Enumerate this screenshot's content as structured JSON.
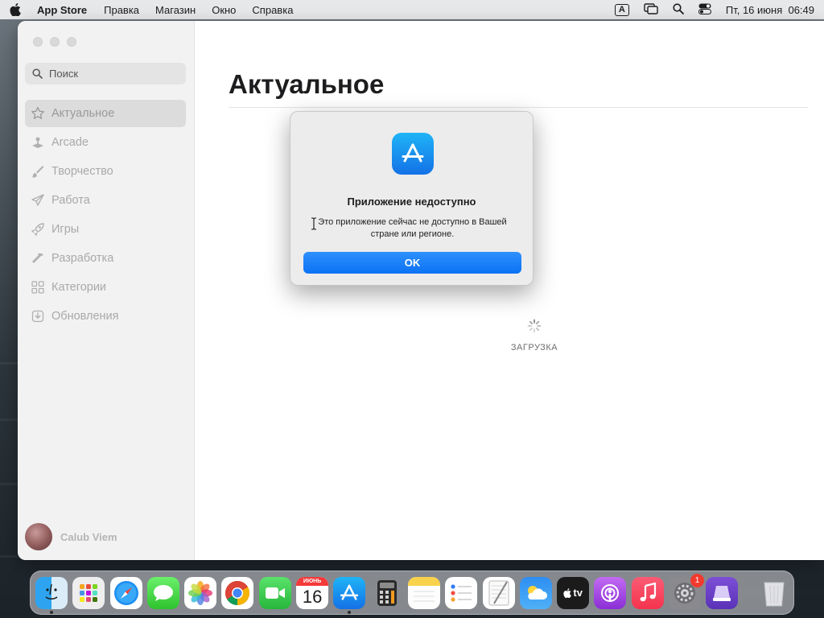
{
  "menubar": {
    "app_name": "App Store",
    "items": [
      "Правка",
      "Магазин",
      "Окно",
      "Справка"
    ],
    "input_source": "A",
    "datetime": "Пт, 16 июня  06:49"
  },
  "sidebar": {
    "search_placeholder": "Поиск",
    "items": [
      {
        "label": "Актуальное",
        "icon": "star-icon",
        "active": true
      },
      {
        "label": "Arcade",
        "icon": "joystick-icon",
        "active": false
      },
      {
        "label": "Творчество",
        "icon": "paintbrush-icon",
        "active": false
      },
      {
        "label": "Работа",
        "icon": "paperplane-icon",
        "active": false
      },
      {
        "label": "Игры",
        "icon": "rocket-icon",
        "active": false
      },
      {
        "label": "Разработка",
        "icon": "hammer-icon",
        "active": false
      },
      {
        "label": "Категории",
        "icon": "grid-icon",
        "active": false
      },
      {
        "label": "Обновления",
        "icon": "download-icon",
        "active": false
      }
    ],
    "user_name": "Calub Viem"
  },
  "main": {
    "title": "Актуальное",
    "loading_label": "ЗАГРУЗКА"
  },
  "dialog": {
    "title": "Приложение недоступно",
    "message": "Это приложение сейчас не доступно в Вашей стране или регионе.",
    "ok_label": "OK"
  },
  "dock": {
    "calendar_month": "ИЮНЬ",
    "calendar_day": "16",
    "tv_label": "tv",
    "settings_badge": "1",
    "apps": [
      "finder-icon",
      "launchpad-icon",
      "safari-icon",
      "messages-icon",
      "photos-icon",
      "chrome-icon",
      "facetime-icon",
      "calendar-icon",
      "appstore-icon",
      "calculator-icon",
      "notes-icon",
      "reminders-icon",
      "textedit-icon",
      "weather-icon",
      "appletv-icon",
      "podcasts-icon",
      "music-icon",
      "system-settings-icon",
      "automator-icon",
      "trash-icon"
    ]
  },
  "colors": {
    "accent": "#0a72f5",
    "appstore_gradient_top": "#1fb4f7",
    "badge": "#f23a2f"
  }
}
